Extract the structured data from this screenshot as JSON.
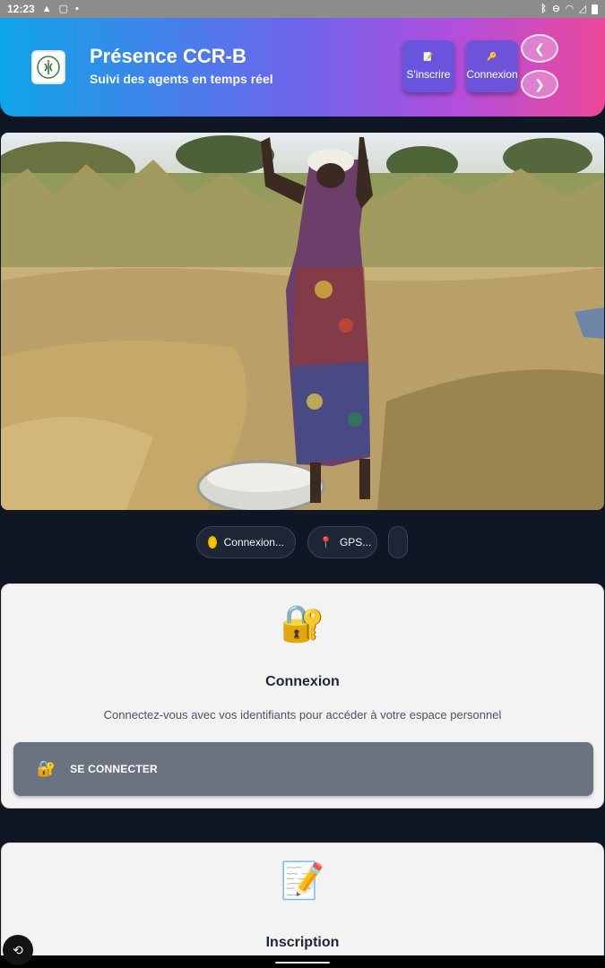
{
  "statusbar": {
    "time": "12:23",
    "left_icons": [
      "warning-icon",
      "square-icon",
      "dot-icon"
    ],
    "right_icons": [
      "bluetooth-icon",
      "dnd-icon",
      "wifi-icon",
      "signal-icon",
      "battery-icon"
    ]
  },
  "header": {
    "title": "Présence CCR-B",
    "subtitle": "Suivi des agents en temps réel",
    "signup_label": "S'inscrire",
    "signup_icon": "📝",
    "login_label": "Connexion",
    "login_icon": "🔑",
    "prev_glyph": "❮",
    "next_glyph": "❯",
    "gradient": [
      "#0ea5e9",
      "#6f64ea",
      "#ec4899"
    ]
  },
  "status_pills": {
    "connection": "Connexion...",
    "gps": "GPS..."
  },
  "login_card": {
    "icon": "🔐",
    "title": "Connexion",
    "description": "Connectez-vous avec vos identifiants pour accéder à votre espace personnel",
    "button_icon": "🔐",
    "button_label": "SE CONNECTER"
  },
  "signup_card": {
    "icon": "📝",
    "title": "Inscription"
  },
  "colors": {
    "page_bg": "#0f1624",
    "card_bg": "#f3f3f4",
    "button_gray": "#6b7280",
    "status_yellow": "#f8c400"
  }
}
